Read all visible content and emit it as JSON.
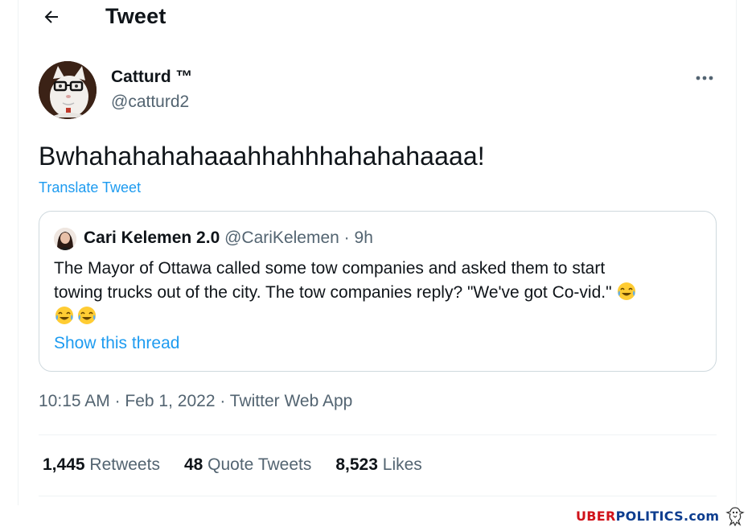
{
  "header": {
    "title": "Tweet",
    "back_icon": "arrow-left-icon"
  },
  "tweet": {
    "author_name": "Catturd ™",
    "author_handle": "@catturd2",
    "text": "Bwhahahahahaaahhahhhahahahaaaa!",
    "translate_label": "Translate Tweet",
    "more_icon": "more-horizontal-icon"
  },
  "quote": {
    "name": "Cari Kelemen 2.0",
    "handle": "@CariKelemen",
    "separator": "·",
    "time": "9h",
    "line1": "The Mayor of Ottawa called some tow companies and asked them to start",
    "line2": "towing trucks out of the city. The tow companies reply? \"We've got Co-vid.\"",
    "emoji_name": "face-with-tears-of-joy-icon",
    "show_thread_label": "Show this thread"
  },
  "meta": {
    "time": "10:15 AM",
    "sep1": " · ",
    "date": "Feb 1, 2022",
    "sep2": " · ",
    "source": "Twitter Web App"
  },
  "stats": {
    "retweets_count": "1,445",
    "retweets_label": "Retweets",
    "quotes_count": "48",
    "quotes_label": "Quote Tweets",
    "likes_count": "8,523",
    "likes_label": "Likes"
  },
  "watermark": {
    "part1": "UBER",
    "part2": "POLITICS.com"
  },
  "colors": {
    "link": "#1d9bf0",
    "secondary": "#536471",
    "primary": "#0f1419",
    "border": "#cfd9de"
  }
}
